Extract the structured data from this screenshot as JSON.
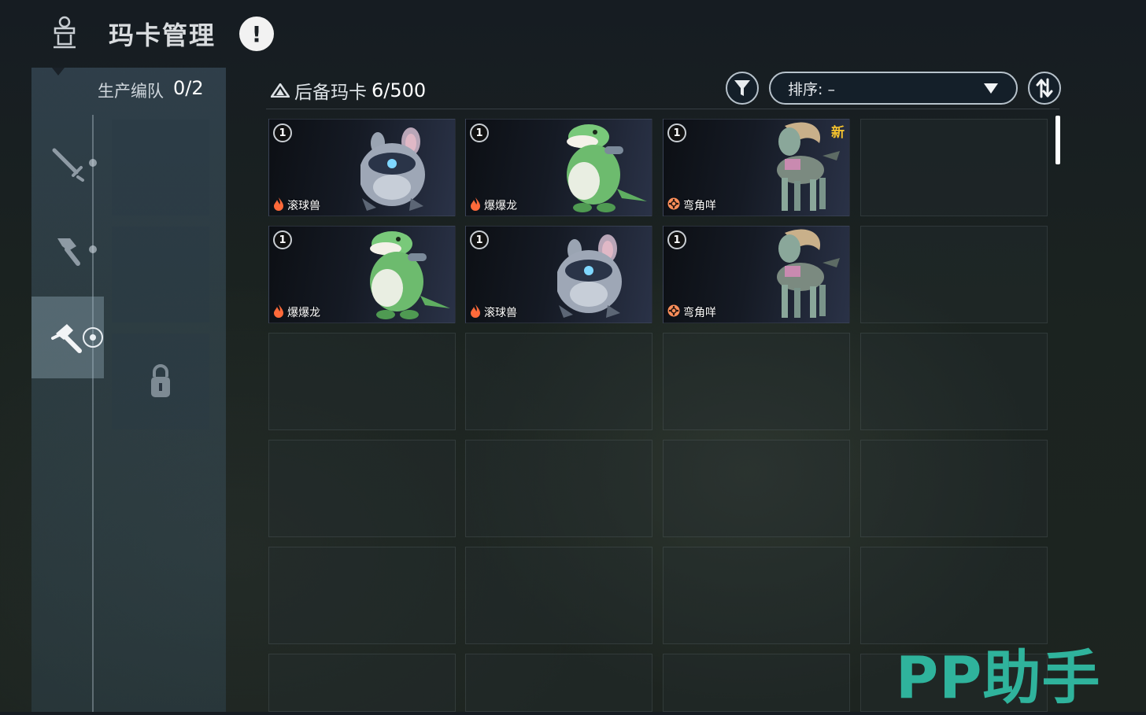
{
  "header": {
    "title": "玛卡管理",
    "info_symbol": "!"
  },
  "sidebar": {
    "team_label": "生产编队",
    "team_count": "0/2",
    "tabs": [
      {
        "icon": "crossed-swords-icon",
        "active": false
      },
      {
        "icon": "axe-icon",
        "active": false
      },
      {
        "icon": "hammer-icon",
        "active": true
      }
    ]
  },
  "toolbar": {
    "backup_label": "后备玛卡",
    "backup_count": "6/500",
    "sort_label": "排序: –"
  },
  "cards": [
    {
      "level": "1",
      "name": "滚球兽",
      "element": "fire",
      "creature": "round-robot",
      "is_new": false
    },
    {
      "level": "1",
      "name": "爆爆龙",
      "element": "fire",
      "creature": "green-dino",
      "is_new": false
    },
    {
      "level": "1",
      "name": "弯角咩",
      "element": "mech",
      "creature": "ram-robot",
      "is_new": true
    },
    {
      "level": "1",
      "name": "爆爆龙",
      "element": "fire",
      "creature": "green-dino",
      "is_new": false
    },
    {
      "level": "1",
      "name": "滚球兽",
      "element": "fire",
      "creature": "round-robot",
      "is_new": false
    },
    {
      "level": "1",
      "name": "弯角咩",
      "element": "mech",
      "creature": "ram-robot",
      "is_new": false
    }
  ],
  "new_tag": "新",
  "watermark": "PP助手",
  "colors": {
    "accent_new": "#f3c12e",
    "fire": "#ff6a3a",
    "mech": "#ff8f5a",
    "watermark": "#2fb39c"
  }
}
